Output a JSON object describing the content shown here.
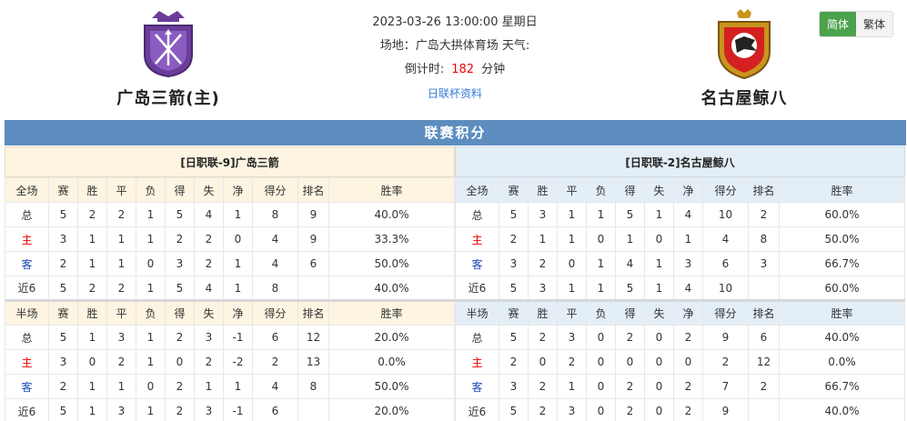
{
  "match": {
    "datetime": "2023-03-26 13:00:00 星期日",
    "venue_line": "场地：广岛大拱体育场 天气:",
    "countdown_prefix": "倒计时:",
    "countdown_value": "182",
    "countdown_suffix": "分钟",
    "cup_link": "日联杯资料"
  },
  "home_team": {
    "name": "广岛三箭(主)",
    "logo_icon": "sanfrecce-hiroshima-crest-icon"
  },
  "away_team": {
    "name": "名古屋鲸八",
    "logo_icon": "nagoya-grampus-crest-icon"
  },
  "lang": {
    "simplified": "简体",
    "traditional": "繁体"
  },
  "section_title": "联赛积分",
  "colors": {
    "header_bar": "#5d8dbf",
    "home_label": "#e00000",
    "away_label": "#1a49b8",
    "active_lang": "#4ba24b"
  },
  "home_panel": {
    "title": "[日职联-9]广岛三箭",
    "full_headers": [
      "全场",
      "赛",
      "胜",
      "平",
      "负",
      "得",
      "失",
      "净",
      "得分",
      "排名",
      "胜率"
    ],
    "full_rows": [
      [
        "总",
        "5",
        "2",
        "2",
        "1",
        "5",
        "4",
        "1",
        "8",
        "9",
        "40.0%"
      ],
      [
        "主",
        "3",
        "1",
        "1",
        "1",
        "2",
        "2",
        "0",
        "4",
        "9",
        "33.3%"
      ],
      [
        "客",
        "2",
        "1",
        "1",
        "0",
        "3",
        "2",
        "1",
        "4",
        "6",
        "50.0%"
      ],
      [
        "近6",
        "5",
        "2",
        "2",
        "1",
        "5",
        "4",
        "1",
        "8",
        "",
        "40.0%"
      ]
    ],
    "half_headers": [
      "半场",
      "赛",
      "胜",
      "平",
      "负",
      "得",
      "失",
      "净",
      "得分",
      "排名",
      "胜率"
    ],
    "half_rows": [
      [
        "总",
        "5",
        "1",
        "3",
        "1",
        "2",
        "3",
        "-1",
        "6",
        "12",
        "20.0%"
      ],
      [
        "主",
        "3",
        "0",
        "2",
        "1",
        "0",
        "2",
        "-2",
        "2",
        "13",
        "0.0%"
      ],
      [
        "客",
        "2",
        "1",
        "1",
        "0",
        "2",
        "1",
        "1",
        "4",
        "8",
        "50.0%"
      ],
      [
        "近6",
        "5",
        "1",
        "3",
        "1",
        "2",
        "3",
        "-1",
        "6",
        "",
        "20.0%"
      ]
    ]
  },
  "away_panel": {
    "title": "[日职联-2]名古屋鲸八",
    "full_headers": [
      "全场",
      "赛",
      "胜",
      "平",
      "负",
      "得",
      "失",
      "净",
      "得分",
      "排名",
      "胜率"
    ],
    "full_rows": [
      [
        "总",
        "5",
        "3",
        "1",
        "1",
        "5",
        "1",
        "4",
        "10",
        "2",
        "60.0%"
      ],
      [
        "主",
        "2",
        "1",
        "1",
        "0",
        "1",
        "0",
        "1",
        "4",
        "8",
        "50.0%"
      ],
      [
        "客",
        "3",
        "2",
        "0",
        "1",
        "4",
        "1",
        "3",
        "6",
        "3",
        "66.7%"
      ],
      [
        "近6",
        "5",
        "3",
        "1",
        "1",
        "5",
        "1",
        "4",
        "10",
        "",
        "60.0%"
      ]
    ],
    "half_headers": [
      "半场",
      "赛",
      "胜",
      "平",
      "负",
      "得",
      "失",
      "净",
      "得分",
      "排名",
      "胜率"
    ],
    "half_rows": [
      [
        "总",
        "5",
        "2",
        "3",
        "0",
        "2",
        "0",
        "2",
        "9",
        "6",
        "40.0%"
      ],
      [
        "主",
        "2",
        "0",
        "2",
        "0",
        "0",
        "0",
        "0",
        "2",
        "12",
        "0.0%"
      ],
      [
        "客",
        "3",
        "2",
        "1",
        "0",
        "2",
        "0",
        "2",
        "7",
        "2",
        "66.7%"
      ],
      [
        "近6",
        "5",
        "2",
        "3",
        "0",
        "2",
        "0",
        "2",
        "9",
        "",
        "40.0%"
      ]
    ]
  }
}
